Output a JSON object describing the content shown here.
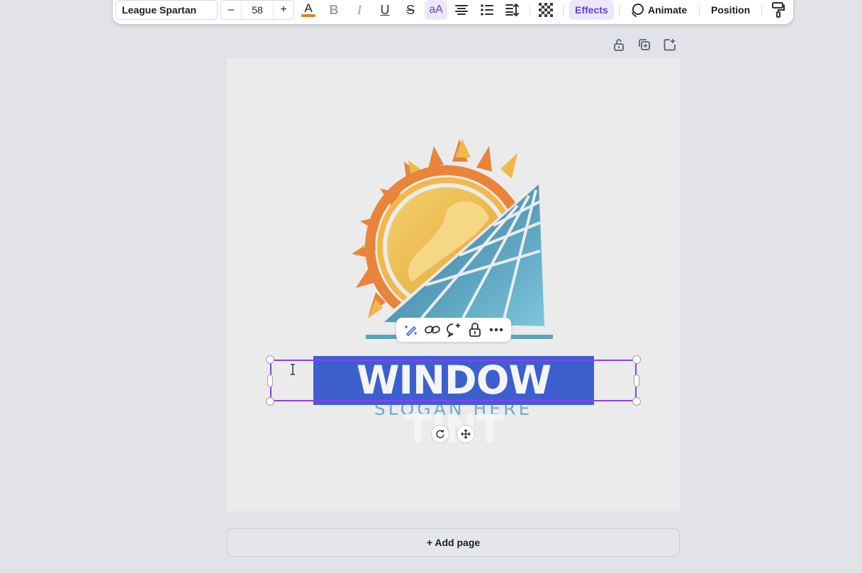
{
  "toolbar": {
    "font_family": "League Spartan",
    "font_size_decrease": "–",
    "font_size": "58",
    "font_size_increase": "+",
    "text_color_letter": "A",
    "text_color": "#d9822b",
    "case_toggle": "aA",
    "effects_label": "Effects",
    "animate_label": "Animate",
    "position_label": "Position",
    "icons": [
      "text-color-icon",
      "bold-icon",
      "italic-icon",
      "underline-icon",
      "strikethrough-icon",
      "letter-case-icon",
      "align-center-icon",
      "bulleted-list-icon",
      "spacing-icon",
      "transparency-icon",
      "animate-icon",
      "copy-style-icon"
    ]
  },
  "page_actions": [
    "lock-icon",
    "duplicate-page-icon",
    "add-page-icon"
  ],
  "context_menu": [
    "magic-edit-icon",
    "link-icon",
    "comment-icon",
    "lock-icon",
    "more-icon"
  ],
  "canvas": {
    "headline": "WINDOW TINT",
    "slogan": "SLOGAN HERE",
    "selection_color": "#8b3dff",
    "highlight_color": "#3d5fce"
  },
  "add_page_label": "+ Add page"
}
